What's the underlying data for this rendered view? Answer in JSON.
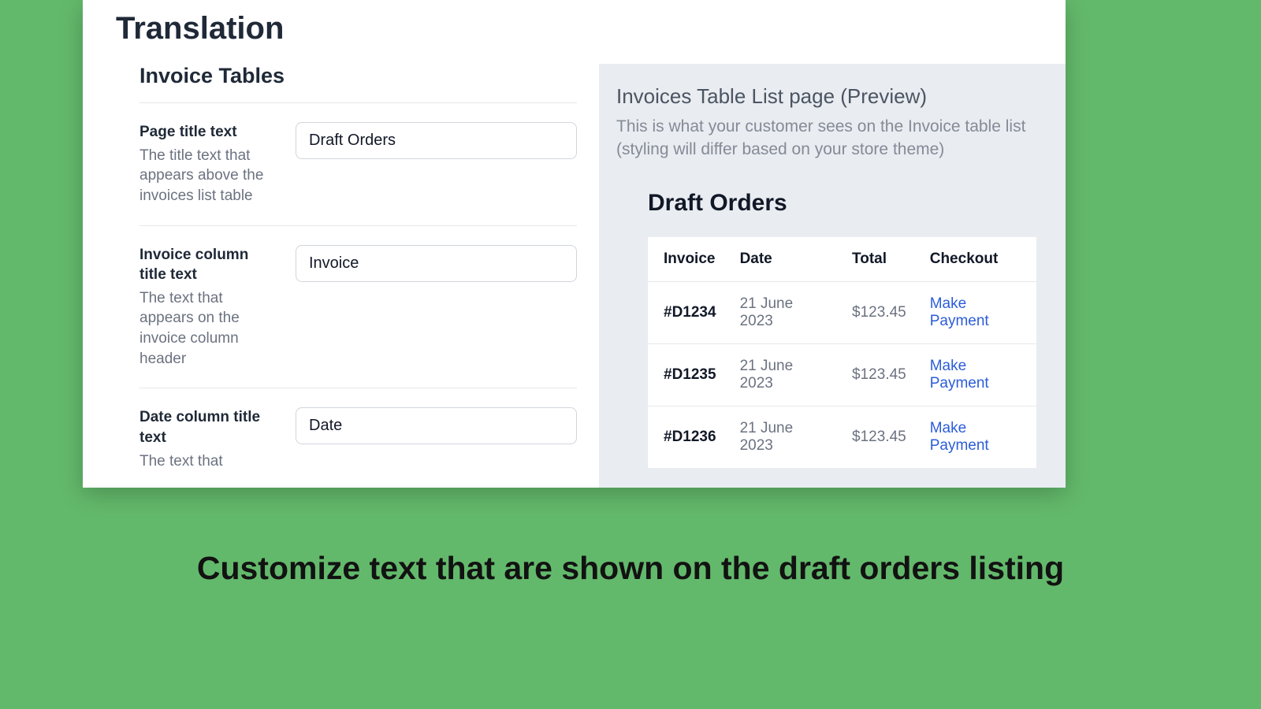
{
  "page": {
    "title": "Translation"
  },
  "section": {
    "heading": "Invoice Tables"
  },
  "fields": [
    {
      "label": "Page title text",
      "help": "The title text that appears above the invoices list table",
      "value": "Draft Orders"
    },
    {
      "label": "Invoice column title text",
      "help": "The text that appears on the invoice column header",
      "value": "Invoice"
    },
    {
      "label": "Date column title text",
      "help": "The text that",
      "value": "Date"
    }
  ],
  "preview": {
    "title": "Invoices Table List page (Preview)",
    "subtitle": "This is what your customer sees on the Invoice table list (styling will differ based on your store theme)",
    "heading": "Draft Orders",
    "columns": {
      "invoice": "Invoice",
      "date": "Date",
      "total": "Total",
      "checkout": "Checkout"
    },
    "action_label": "Make Payment",
    "rows": [
      {
        "invoice": "#D1234",
        "date": "21 June 2023",
        "total": "$123.45"
      },
      {
        "invoice": "#D1235",
        "date": "21 June 2023",
        "total": "$123.45"
      },
      {
        "invoice": "#D1236",
        "date": "21 June 2023",
        "total": "$123.45"
      }
    ]
  },
  "caption": "Customize text that are shown on the draft orders listing"
}
